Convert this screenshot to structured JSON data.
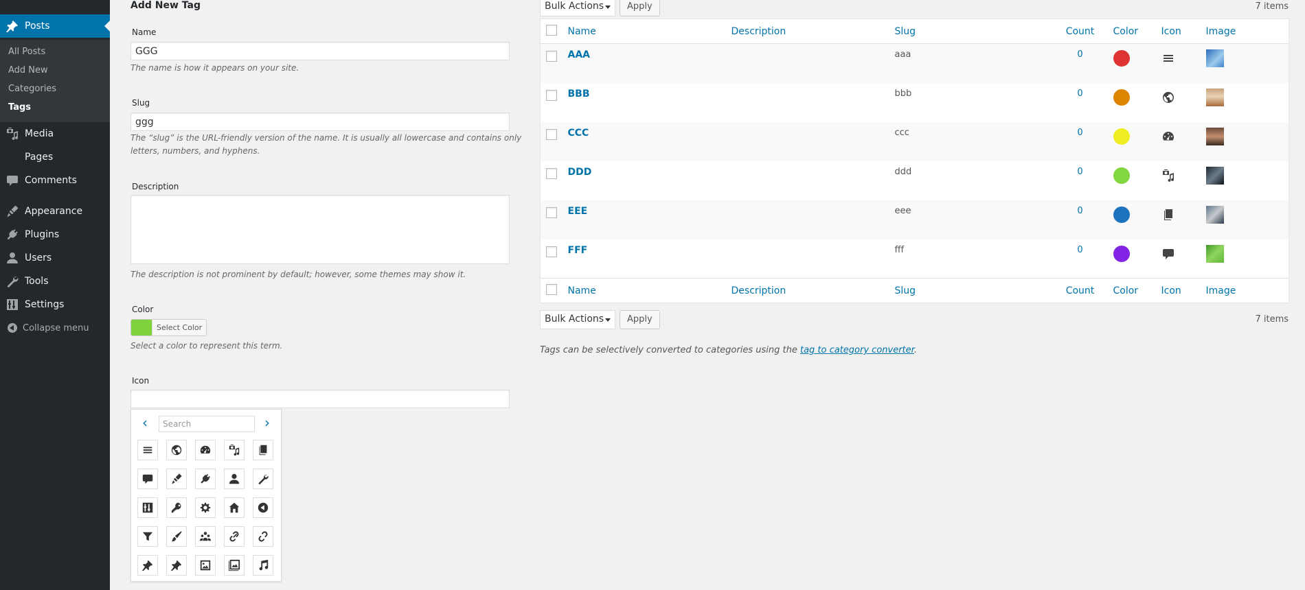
{
  "sidebar": {
    "items": [
      {
        "label": "Posts",
        "icon": "pin-icon"
      },
      {
        "label": "Media",
        "icon": "media-icon"
      },
      {
        "label": "Pages",
        "icon": "pages-icon"
      },
      {
        "label": "Comments",
        "icon": "comment-icon"
      },
      {
        "label": "Appearance",
        "icon": "appearance-brush-icon"
      },
      {
        "label": "Plugins",
        "icon": "plugin-icon"
      },
      {
        "label": "Users",
        "icon": "user-icon"
      },
      {
        "label": "Tools",
        "icon": "wrench-icon"
      },
      {
        "label": "Settings",
        "icon": "settings-icon"
      }
    ],
    "submenu": [
      "All Posts",
      "Add New",
      "Categories",
      "Tags"
    ],
    "collapse_label": "Collapse menu"
  },
  "form": {
    "heading": "Add New Tag",
    "name_label": "Name",
    "name_value": "GGG",
    "name_help": "The name is how it appears on your site.",
    "slug_label": "Slug",
    "slug_value": "ggg",
    "slug_help": "The “slug” is the URL-friendly version of the name. It is usually all lowercase and contains only letters, numbers, and hyphens.",
    "desc_label": "Description",
    "desc_value": "",
    "desc_help": "The description is not prominent by default; however, some themes may show it.",
    "color_label": "Color",
    "color_value": "#7ed33d",
    "color_button": "Select Color",
    "color_help": "Select a color to represent this term.",
    "icon_label": "Icon",
    "icon_value": "",
    "picker": {
      "search_placeholder": "Search",
      "prev": "‹",
      "next": "›",
      "icons": [
        "menu-icon",
        "globe-icon",
        "dashboard-icon",
        "media-icon",
        "copy-icon",
        "comment-icon",
        "appearance-brush-icon",
        "plugin-icon",
        "user-icon",
        "wrench-icon",
        "settings-icon",
        "key-icon",
        "gear-icon",
        "home-icon",
        "collapse-icon",
        "filter-icon",
        "brush-icon",
        "groups-icon",
        "link-icon",
        "unlink-icon",
        "pin-icon",
        "pin-alt-icon",
        "image-icon",
        "gallery-icon",
        "music-icon"
      ]
    }
  },
  "list": {
    "bulk_label": "Bulk Actions",
    "apply_label": "Apply",
    "items_count": "7 items",
    "columns": [
      "Name",
      "Description",
      "Slug",
      "Count",
      "Color",
      "Icon",
      "Image"
    ],
    "rows": [
      {
        "name": "AAA",
        "description": "",
        "slug": "aaa",
        "count": "0",
        "color": "#dd3333",
        "icon": "menu-icon",
        "image": "image-thumbnail-blue"
      },
      {
        "name": "BBB",
        "description": "",
        "slug": "bbb",
        "count": "0",
        "color": "#dd8500",
        "icon": "globe-icon",
        "image": "image-thumbnail-beach"
      },
      {
        "name": "CCC",
        "description": "",
        "slug": "ccc",
        "count": "0",
        "color": "#eeee22",
        "icon": "dashboard-icon",
        "image": "image-thumbnail-car"
      },
      {
        "name": "DDD",
        "description": "",
        "slug": "ddd",
        "count": "0",
        "color": "#81d742",
        "icon": "media-icon",
        "image": "image-thumbnail-dark"
      },
      {
        "name": "EEE",
        "description": "",
        "slug": "eee",
        "count": "0",
        "color": "#1e73be",
        "icon": "copy-icon",
        "image": "image-thumbnail-person"
      },
      {
        "name": "FFF",
        "description": "",
        "slug": "fff",
        "count": "0",
        "color": "#8224e3",
        "icon": "comment-icon",
        "image": "image-thumbnail-green"
      }
    ],
    "note_prefix": "Tags can be selectively converted to categories using the ",
    "note_link": "tag to category converter",
    "note_suffix": "."
  }
}
